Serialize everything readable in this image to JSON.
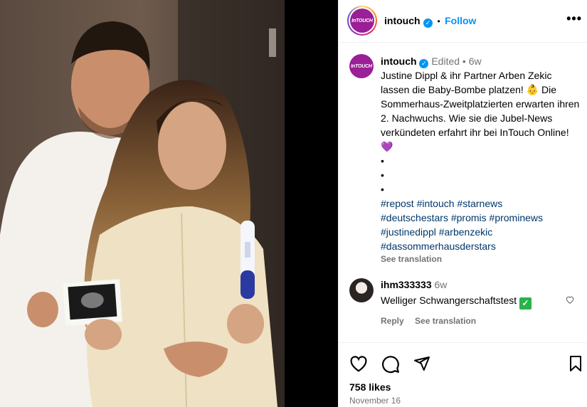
{
  "colors": {
    "link": "#0095f6",
    "hashtag": "#00376b",
    "brand": "#9b1f96",
    "muted": "#737373"
  },
  "post": {
    "author": "intouch",
    "avatar_text": "InTOUCH",
    "follow_label": "Follow",
    "more_label": "•••"
  },
  "caption": {
    "author": "intouch",
    "edited": "Edited",
    "age": "6w",
    "text_line1": "Justine Dippl & ihr Partner Arben Zekic lassen die Baby-Bombe platzen! ",
    "emoji_baby": "👶",
    "text_line2": " Die Sommerhaus-Zweitplatzierten erwarten ihren 2. Nachwuchs. Wie sie die Jubel-News verkündeten erfahrt ihr bei InTouch Online! ",
    "emoji_heart": "💜",
    "bullet": "•",
    "hashtags": [
      "#repost",
      "#intouch",
      "#starnews",
      "#deutschestars",
      "#promis",
      "#prominews",
      "#justinedippl",
      "#arbenzekic",
      "#dassommerhausderstars"
    ],
    "see_translation": "See translation"
  },
  "comment": {
    "author": "ihm333333",
    "age": "6w",
    "text": "Welliger Schwangerschaftstest ",
    "emoji": "✓",
    "reply": "Reply",
    "see_translation": "See translation"
  },
  "footer": {
    "likes": "758 likes",
    "date": "November 16"
  },
  "icons": [
    "heart-icon",
    "comment-icon",
    "share-icon",
    "bookmark-icon",
    "more-icon",
    "verified-icon"
  ]
}
